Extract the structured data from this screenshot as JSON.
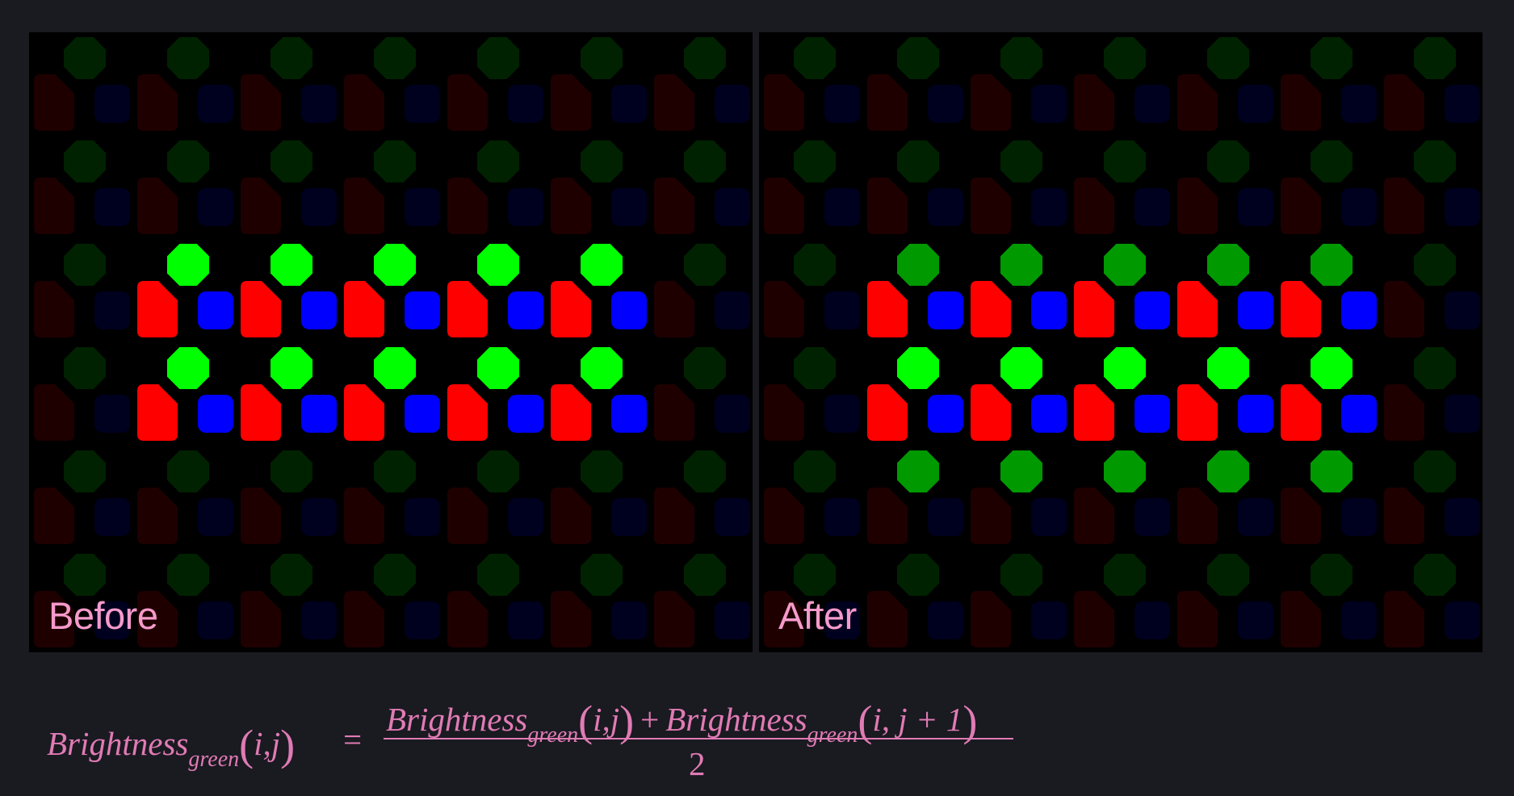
{
  "panels": [
    {
      "id": "before",
      "label": "Before",
      "lit_rows": {
        "rg": [
          2,
          3
        ],
        "g": [
          2,
          3
        ]
      },
      "lit_cols": [
        1,
        2,
        3,
        4,
        5
      ]
    },
    {
      "id": "after",
      "label": "After",
      "lit_rows": {
        "rg": [
          2,
          3
        ],
        "g": [
          2,
          3,
          4
        ]
      },
      "lit_cols": [
        1,
        2,
        3,
        4,
        5
      ],
      "dimmed_green_rows": [
        2,
        4
      ]
    }
  ],
  "colors": {
    "background": "#1a1a21",
    "panel": "#000000",
    "label": "#f59acb",
    "formula": "#e07bb4",
    "red_bright": "#ff0000",
    "green_bright": "#00ff00",
    "green_medium": "#009900",
    "blue_bright": "#0000ff",
    "red_dim": "#1f0000",
    "green_dim": "#002200",
    "blue_dim": "#00001f"
  },
  "formula": {
    "lhs_word": "Brightness",
    "lhs_sub": "green",
    "lhs_args": "i,j",
    "equals": "=",
    "num_word1": "Brightness",
    "num_sub1": "green",
    "num_args1": "i,j",
    "plus": "+",
    "num_word2": "Brightness",
    "num_sub2": "green",
    "num_args2": "i, j + 1",
    "denominator": "2"
  }
}
